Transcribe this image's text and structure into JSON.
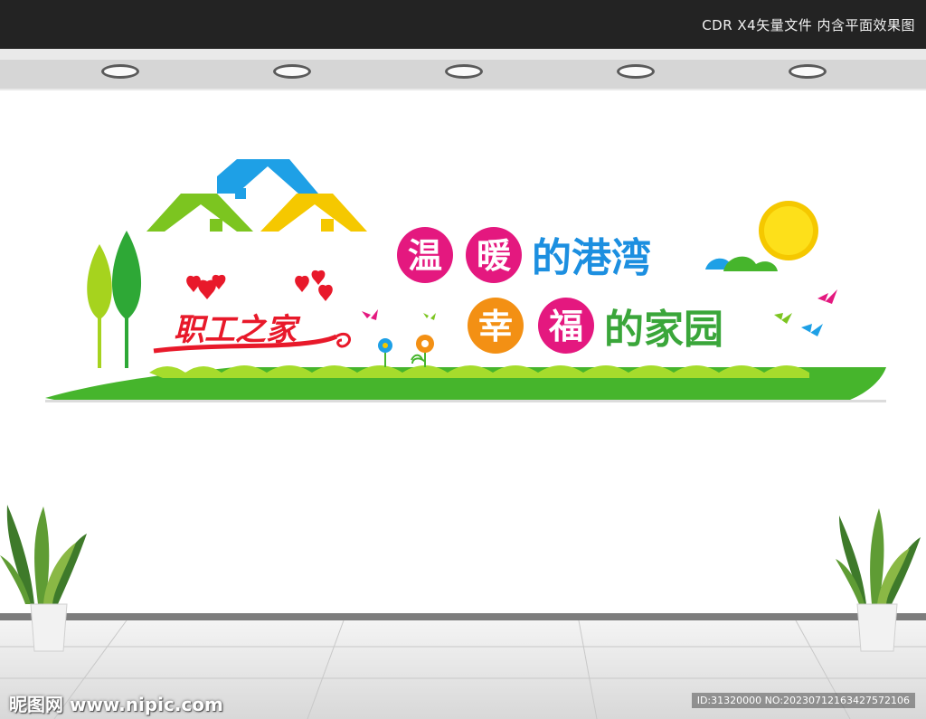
{
  "header": {
    "info": "CDR X4矢量文件  内含平面效果图"
  },
  "logo": {
    "text": "职工之家"
  },
  "slogan": {
    "line1": {
      "circle_chars": [
        "温",
        "暖"
      ],
      "rest": "的港湾",
      "rest_color": "#1c8fe0"
    },
    "line2": {
      "circle_chars": [
        "幸",
        "福"
      ],
      "rest": "的家园",
      "rest_color": "#3aa63a"
    }
  },
  "colors": {
    "circle1": "#e4187f",
    "circle2": "#e4187f",
    "circle3": "#f39014",
    "circle4": "#e4187f",
    "grass_dark": "#46b52c",
    "grass_light": "#a6dc2c",
    "logo_red": "#e8192a"
  },
  "watermark": {
    "site": "昵图网 www.nipic.com",
    "id": "ID:31320000 NO:20230712163427572106"
  }
}
